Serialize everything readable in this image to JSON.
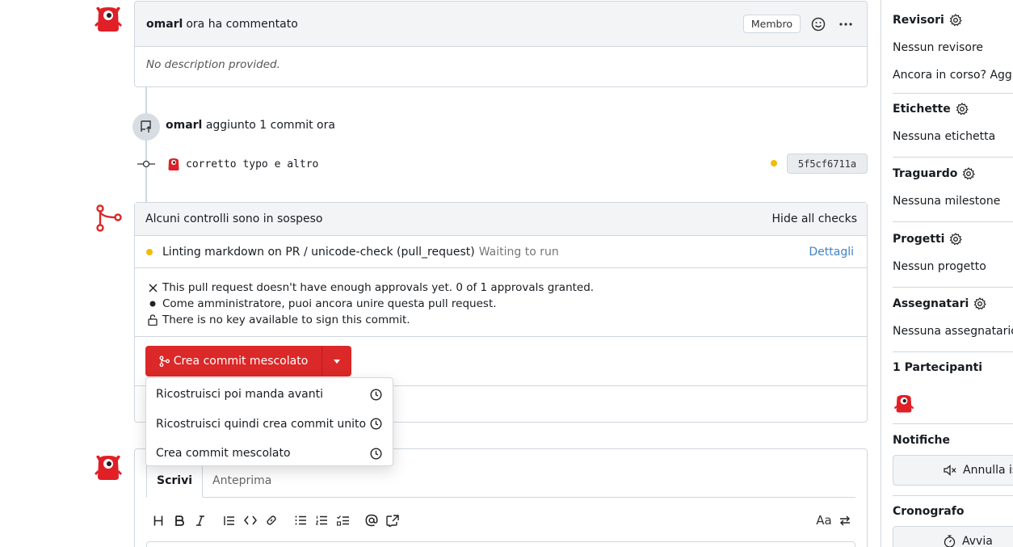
{
  "comment": {
    "author": "omarl",
    "action": "ora ha commentato",
    "badge": "Membro",
    "body": "No description provided."
  },
  "push": {
    "author": "omarl",
    "action": "aggiunto 1 commit ora"
  },
  "commit": {
    "message": "corretto typo e altro",
    "sha": "5f5cf6711a",
    "status_color": "#f2bb05"
  },
  "mergebox": {
    "header": "Alcuni controlli sono in sospeso",
    "toggle_checks": "Hide all checks",
    "check": {
      "name": "Linting markdown on PR / unicode-check (pull_request)",
      "status": "Waiting to run",
      "details": "Dettagli"
    },
    "notes": [
      "This pull request doesn't have enough approvals yet. 0 of 1 approvals granted.",
      "Come amministratore, puoi ancora unire questa pull request.",
      "There is no key available to sign this commit."
    ],
    "merge_button": "Crea commit mescolato",
    "dropdown_options": [
      "Ricostruisci poi manda avanti",
      "Ricostruisci quindi crea commit unito",
      "Crea commit mescolato"
    ]
  },
  "editor": {
    "tab_write": "Scrivi",
    "tab_preview": "Anteprima",
    "toolbar_right_label": "Aa"
  },
  "sidebar": {
    "reviewers_title": "Revisori",
    "reviewers_value": "Nessun revisore",
    "wip_text": "Ancora in corso? Aggiu",
    "labels_title": "Etichette",
    "labels_value": "Nessuna etichetta",
    "milestone_title": "Traguardo",
    "milestone_value": "Nessuna milestone",
    "projects_title": "Progetti",
    "projects_value": "Nessun progetto",
    "assignees_title": "Assegnatari",
    "assignees_value": "Nessuna assegnatario",
    "participants_title": "1 Partecipanti",
    "notifications_title": "Notifiche",
    "notifications_button": "Annulla is",
    "stopwatch_title": "Cronografo",
    "stopwatch_button": "Avvia"
  },
  "colors": {
    "accent_red": "#db2828",
    "link_blue": "#4183c4",
    "header_bg": "#f3f4f6",
    "border": "#d0d7de"
  }
}
